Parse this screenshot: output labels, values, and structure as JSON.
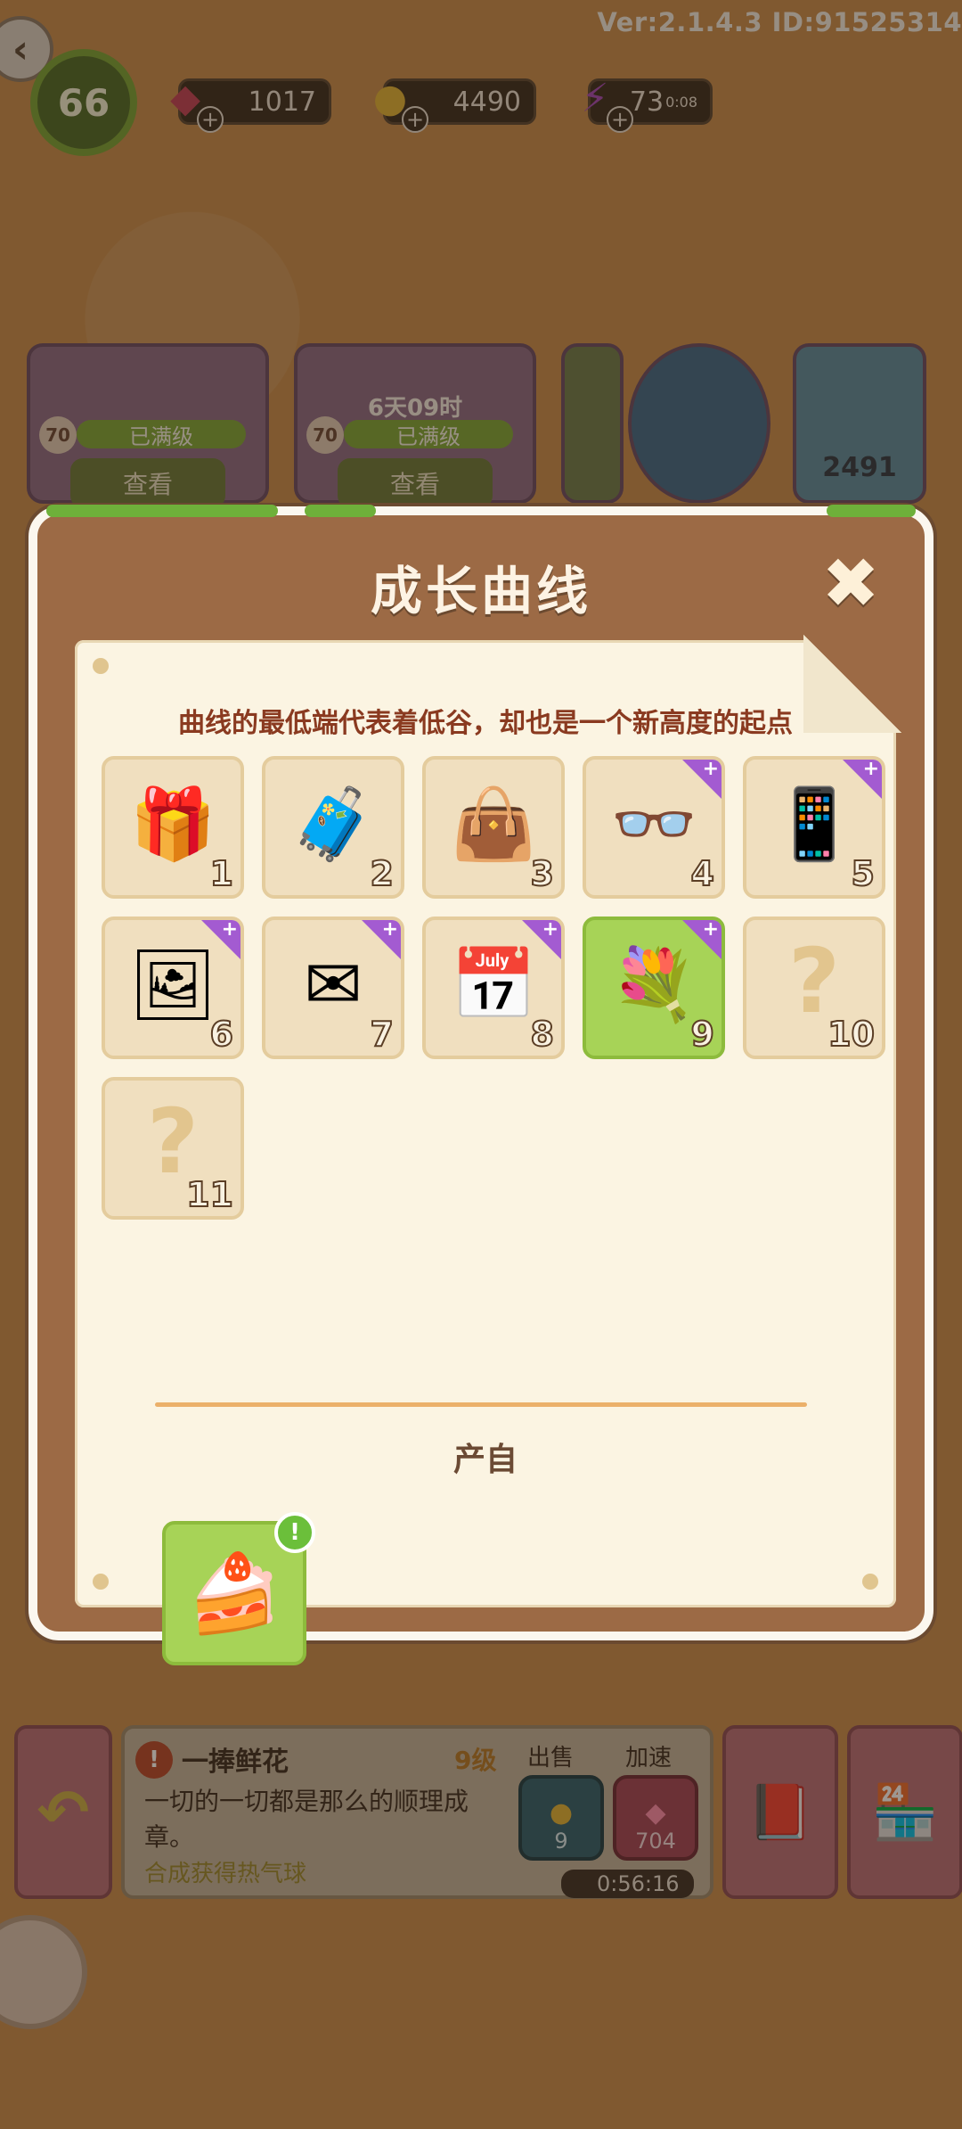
{
  "header": {
    "version": "Ver:2.1.4.3 ID:91525314",
    "level": "66",
    "gems": "1017",
    "coins": "4490",
    "energy": "73",
    "energy_timer": "0:08"
  },
  "cards": [
    {
      "level": "70",
      "status": "已满级",
      "button": "查看"
    },
    {
      "level": "70",
      "status": "已满级",
      "button": "查看",
      "timer": "6天09时"
    },
    {
      "count": "2491"
    }
  ],
  "modal": {
    "title": "成长曲线",
    "subtitle": "曲线的最低端代表着低谷，却也是一个新高度的起点",
    "produce_label": "产自",
    "items": [
      {
        "num": "1",
        "icon": "🎁",
        "plus": false,
        "active": false
      },
      {
        "num": "2",
        "icon": "🧳",
        "plus": false,
        "active": false
      },
      {
        "num": "3",
        "icon": "👜",
        "plus": false,
        "active": false
      },
      {
        "num": "4",
        "icon": "👓",
        "plus": true,
        "active": false
      },
      {
        "num": "5",
        "icon": "📱",
        "plus": true,
        "active": false
      },
      {
        "num": "6",
        "icon": "🖼",
        "plus": true,
        "active": false
      },
      {
        "num": "7",
        "icon": "✉",
        "plus": true,
        "active": false
      },
      {
        "num": "8",
        "icon": "📅",
        "plus": true,
        "active": false
      },
      {
        "num": "9",
        "icon": "💐",
        "plus": true,
        "active": true
      },
      {
        "num": "10",
        "icon": "?",
        "plus": false,
        "active": false
      },
      {
        "num": "11",
        "icon": "?",
        "plus": false,
        "active": false
      }
    ],
    "source_item": {
      "icon": "🍰",
      "badge": "!"
    }
  },
  "bottom": {
    "info_icon": "!",
    "name": "一捧鲜花",
    "level": "9级",
    "desc": "一切的一切都是那么的顺理成章。",
    "hint": "合成获得热气球",
    "sell_label": "出售",
    "speed_label": "加速",
    "sell_value": "9",
    "speed_value": "704",
    "time": "0:56:16"
  }
}
